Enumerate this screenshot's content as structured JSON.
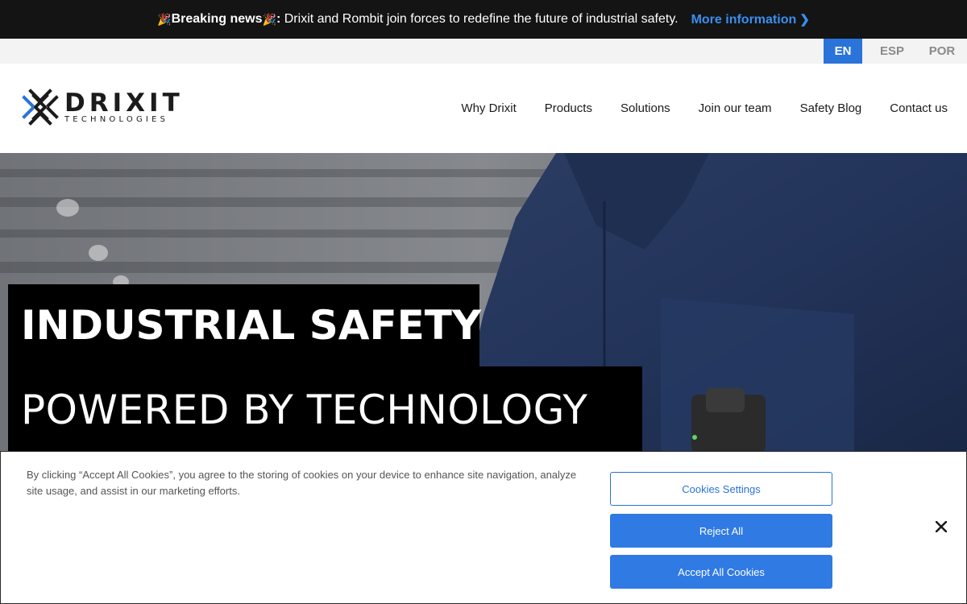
{
  "announcement": {
    "emoji": "🎉",
    "label": "Breaking news",
    "colon": ":",
    "message": "Drixit and Rombit join forces to redefine the future of industrial safety.",
    "link_label": "More information",
    "link_chevron": "❯"
  },
  "languages": [
    {
      "label": "EN",
      "active": true
    },
    {
      "label": "ESP",
      "active": false
    },
    {
      "label": "POR",
      "active": false
    }
  ],
  "brand": {
    "name": "DRIXIT",
    "tagline": "TECHNOLOGIES"
  },
  "nav": {
    "items": [
      "Why Drixit",
      "Products",
      "Solutions",
      "Join our team",
      "Safety Blog",
      "Contact us"
    ]
  },
  "hero": {
    "title_line1": "INDUSTRIAL SAFETY",
    "title_line2": "POWERED BY TECHNOLOGY"
  },
  "cookie_banner": {
    "text": "By clicking “Accept All Cookies”, you agree to the storing of cookies on your device to enhance site navigation, analyze site usage, and assist in our marketing efforts.",
    "settings_label": "Cookies Settings",
    "reject_label": "Reject All",
    "accept_label": "Accept All Cookies",
    "close_symbol": "×"
  },
  "colors": {
    "accent": "#2a73d9",
    "link": "#3a8ff0",
    "announcement_bg": "#141414"
  }
}
